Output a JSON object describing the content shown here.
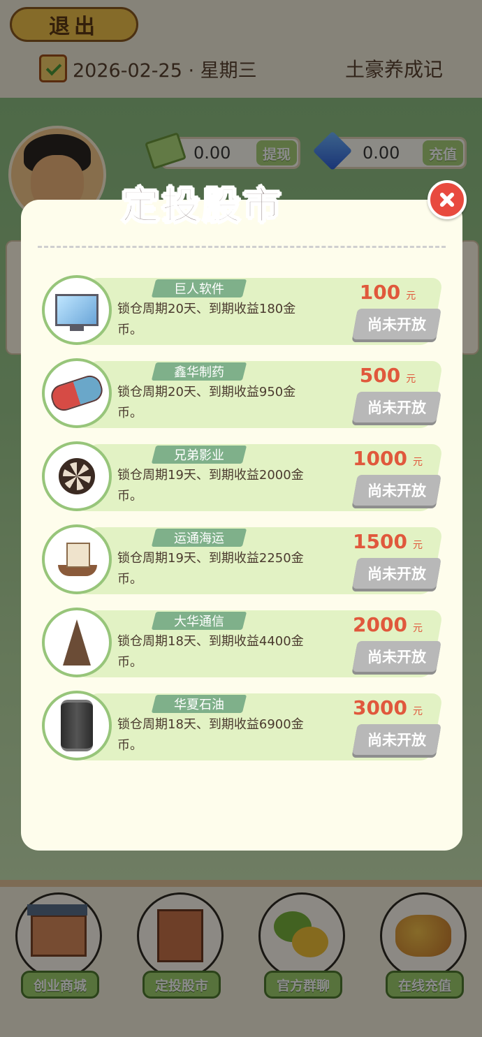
{
  "header": {
    "exit_label": "退出",
    "date": "2026-02-25 · 星期三",
    "app_name": "土豪养成记"
  },
  "wallet": {
    "cash_value": "0.00",
    "cash_button": "提现",
    "gem_value": "0.00",
    "gem_button": "充值"
  },
  "modal": {
    "title": "定投股市",
    "items": [
      {
        "name": "巨人软件",
        "desc": "锁仓周期20天、到期收益180金币。",
        "price": "100",
        "unit": "元",
        "status": "尚未开放",
        "icon": "monitor-icon"
      },
      {
        "name": "鑫华制药",
        "desc": "锁仓周期20天、到期收益950金币。",
        "price": "500",
        "unit": "元",
        "status": "尚未开放",
        "icon": "pill-icon"
      },
      {
        "name": "兄弟影业",
        "desc": "锁仓周期19天、到期收益2000金币。",
        "price": "1000",
        "unit": "元",
        "status": "尚未开放",
        "icon": "film-reel-icon"
      },
      {
        "name": "运通海运",
        "desc": "锁仓周期19天、到期收益2250金币。",
        "price": "1500",
        "unit": "元",
        "status": "尚未开放",
        "icon": "ship-icon"
      },
      {
        "name": "大华通信",
        "desc": "锁仓周期18天、到期收益4400金币。",
        "price": "2000",
        "unit": "元",
        "status": "尚未开放",
        "icon": "signal-tower-icon"
      },
      {
        "name": "华夏石油",
        "desc": "锁仓周期18天、到期收益6900金币。",
        "price": "3000",
        "unit": "元",
        "status": "尚未开放",
        "icon": "oil-barrel-icon"
      }
    ]
  },
  "nav": {
    "items": [
      {
        "label": "创业商城",
        "icon": "shop-icon"
      },
      {
        "label": "定投股市",
        "icon": "stock-building-icon"
      },
      {
        "label": "官方群聊",
        "icon": "chat-icon"
      },
      {
        "label": "在线充值",
        "icon": "coins-icon"
      }
    ]
  },
  "colors": {
    "price": "#e0583c",
    "card_bg": "#e2f2c4",
    "name_tag": "#7fb08a",
    "disabled_button": "#b8b8b8",
    "close_button": "#e84a3f"
  }
}
